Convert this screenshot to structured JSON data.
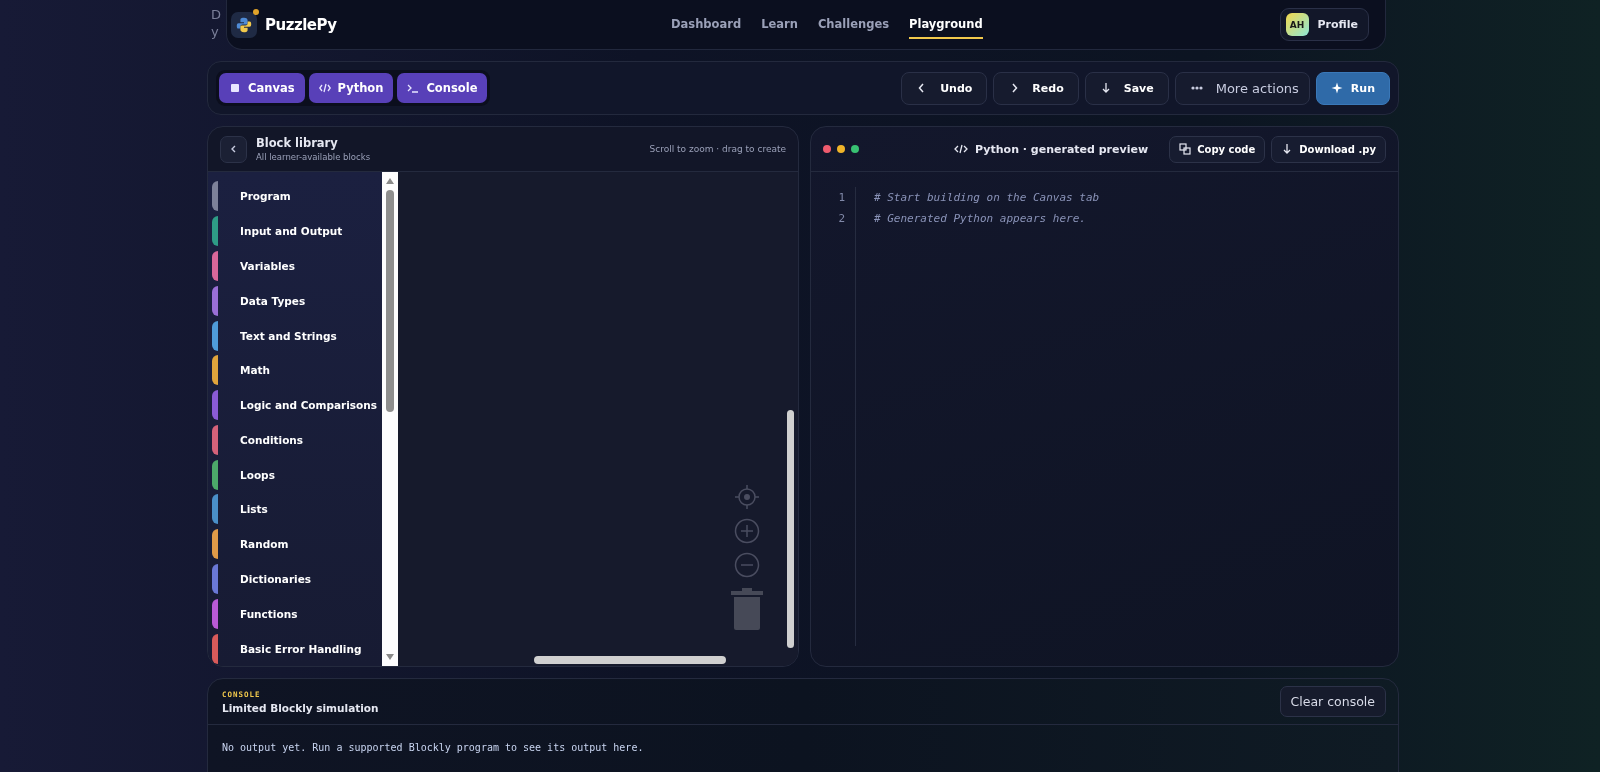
{
  "background_text": [
    "D",
    "y"
  ],
  "header": {
    "brand": "PuzzlePy",
    "nav": [
      {
        "label": "Dashboard",
        "selected": false
      },
      {
        "label": "Learn",
        "selected": false
      },
      {
        "label": "Challenges",
        "selected": false
      },
      {
        "label": "Playground",
        "selected": true
      }
    ],
    "profile": {
      "initials": "AH",
      "label": "Profile"
    }
  },
  "toolbar": {
    "views": [
      {
        "label": "Canvas",
        "active": true
      },
      {
        "label": "Python",
        "active": true
      },
      {
        "label": "Console",
        "active": true
      }
    ],
    "actions": [
      {
        "label": "Undo",
        "kind": "plain"
      },
      {
        "label": "Redo",
        "kind": "plain"
      },
      {
        "label": "Save",
        "kind": "plain"
      },
      {
        "label": "More actions",
        "kind": "light"
      },
      {
        "label": "Run",
        "kind": "primary"
      }
    ]
  },
  "library": {
    "title": "Block library",
    "subtitle": "All learner-available blocks",
    "hint": "Scroll to zoom · drag to create",
    "categories": [
      {
        "label": "Program",
        "color": "#7d8199"
      },
      {
        "label": "Input and Output",
        "color": "#2e9c86"
      },
      {
        "label": "Variables",
        "color": "#d8679a"
      },
      {
        "label": "Data Types",
        "color": "#9a6fd6"
      },
      {
        "label": "Text and Strings",
        "color": "#4f9bd9"
      },
      {
        "label": "Math",
        "color": "#e0a43c"
      },
      {
        "label": "Logic and Comparisons",
        "color": "#8a5bd6"
      },
      {
        "label": "Conditions",
        "color": "#d4627a"
      },
      {
        "label": "Loops",
        "color": "#4caa6a"
      },
      {
        "label": "Lists",
        "color": "#4a8fc8"
      },
      {
        "label": "Random",
        "color": "#e09a48"
      },
      {
        "label": "Dictionaries",
        "color": "#6a78d6"
      },
      {
        "label": "Functions",
        "color": "#b85ad6"
      },
      {
        "label": "Basic Error Handling",
        "color": "#d85a5a"
      }
    ]
  },
  "preview": {
    "title": "Python · generated preview",
    "buttons": [
      {
        "label": "Copy code"
      },
      {
        "label": "Download .py"
      }
    ],
    "lines": [
      {
        "number": "1",
        "code": "# Start building on the Canvas tab"
      },
      {
        "number": "2",
        "code": "# Generated Python appears here."
      }
    ]
  },
  "console": {
    "eyebrow": "CONSOLE",
    "title": "Limited Blockly simulation",
    "clear": "Clear console",
    "output": "No output yet. Run a supported Blockly program to see its output here."
  }
}
